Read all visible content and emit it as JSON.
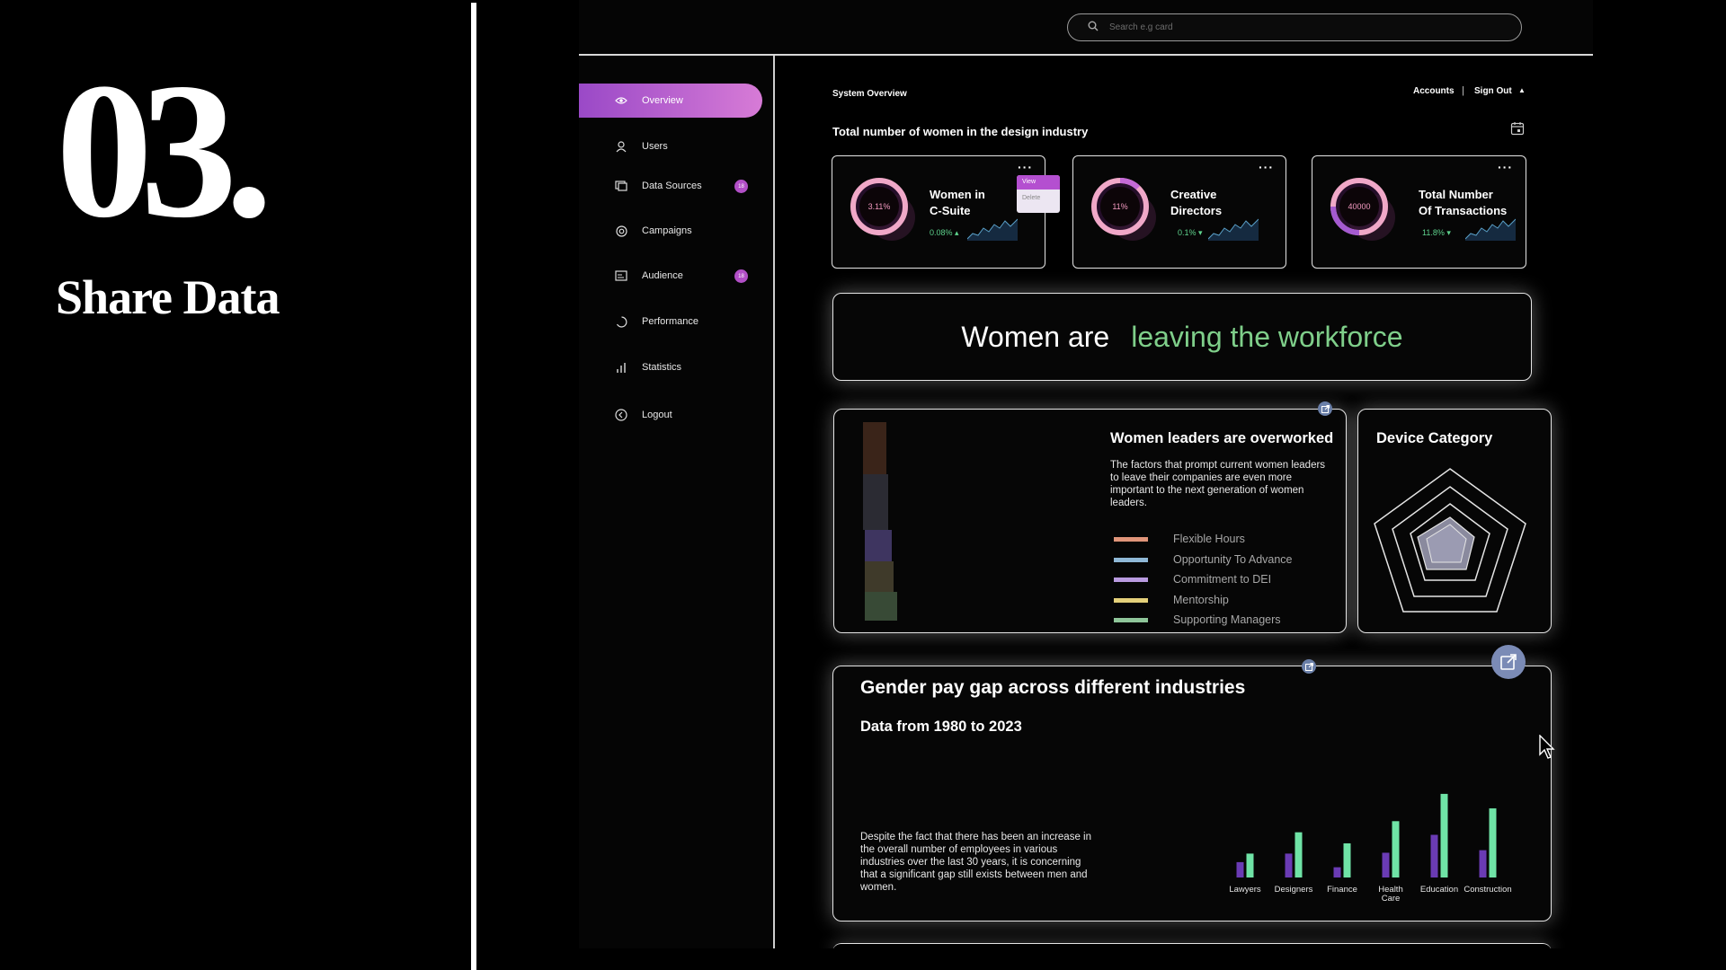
{
  "slide": {
    "number": "03.",
    "title": "Share Data"
  },
  "search": {
    "placeholder": "Search e.g card",
    "icon": "search-icon"
  },
  "sidebar": {
    "items": [
      {
        "label": "Overview",
        "icon": "eye-icon",
        "active": true
      },
      {
        "label": "Users",
        "icon": "user-icon"
      },
      {
        "label": "Data Sources",
        "icon": "database-icon",
        "badge": "18"
      },
      {
        "label": "Campaigns",
        "icon": "target-icon"
      },
      {
        "label": "Audience",
        "icon": "audience-icon",
        "badge": "18"
      },
      {
        "label": "Performance",
        "icon": "performance-icon"
      },
      {
        "label": "Statistics",
        "icon": "statistics-icon"
      },
      {
        "label": "Logout",
        "icon": "logout-icon"
      }
    ]
  },
  "header": {
    "section": "System Overview",
    "accounts": "Accounts",
    "separator": "|",
    "sign_out": "Sign Out"
  },
  "overview": {
    "title": "Total number of women in the design industry"
  },
  "stats": [
    {
      "value": "3.11%",
      "title_line1": "Women in",
      "title_line2": "C-Suite",
      "change": "0.08% ▴"
    },
    {
      "value": "11%",
      "title_line1": "Creative",
      "title_line2": "Directors",
      "change": "0.1% ▾"
    },
    {
      "value": "40000",
      "title_line1": "Total Number",
      "title_line2": "Of Transactions",
      "change": "11.8% ▾"
    }
  ],
  "context_menu": {
    "view": "View",
    "delete": "Delete"
  },
  "banner": {
    "text_white": "Women are",
    "text_green": "leaving the workforce"
  },
  "overworked": {
    "title": "Women leaders are overworked",
    "description": "The factors that prompt current women leaders to leave their companies are even more important to the next generation of women leaders.",
    "legend": [
      {
        "label": "Flexible Hours",
        "color": "#e0957a"
      },
      {
        "label": "Opportunity To Advance",
        "color": "#8fb8d6"
      },
      {
        "label": "Commitment to DEI",
        "color": "#b99be0"
      },
      {
        "label": "Mentorship",
        "color": "#e4d07a"
      },
      {
        "label": "Supporting Managers",
        "color": "#8fc69a"
      }
    ]
  },
  "device": {
    "title": "Device Category"
  },
  "paygap": {
    "title": "Gender pay gap across different industries",
    "subtitle": "Data from 1980 to 2023",
    "description": "Despite the fact that there has been an increase in the overall number of employees in various industries over the last 30 years, it is concerning that a significant gap still exists between men and women."
  },
  "chart_data": {
    "type": "bar",
    "categories": [
      "Lawyers",
      "Designers",
      "Finance",
      "Health Care",
      "Education",
      "Construction"
    ],
    "series": [
      {
        "values": [
          18,
          28,
          12,
          29,
          50,
          32
        ],
        "color": "#6a3bb4"
      },
      {
        "values": [
          28,
          53,
          40,
          66,
          98,
          81
        ],
        "color": "#6fe3a6"
      }
    ],
    "ylim": [
      0,
      100
    ],
    "grid": false
  }
}
